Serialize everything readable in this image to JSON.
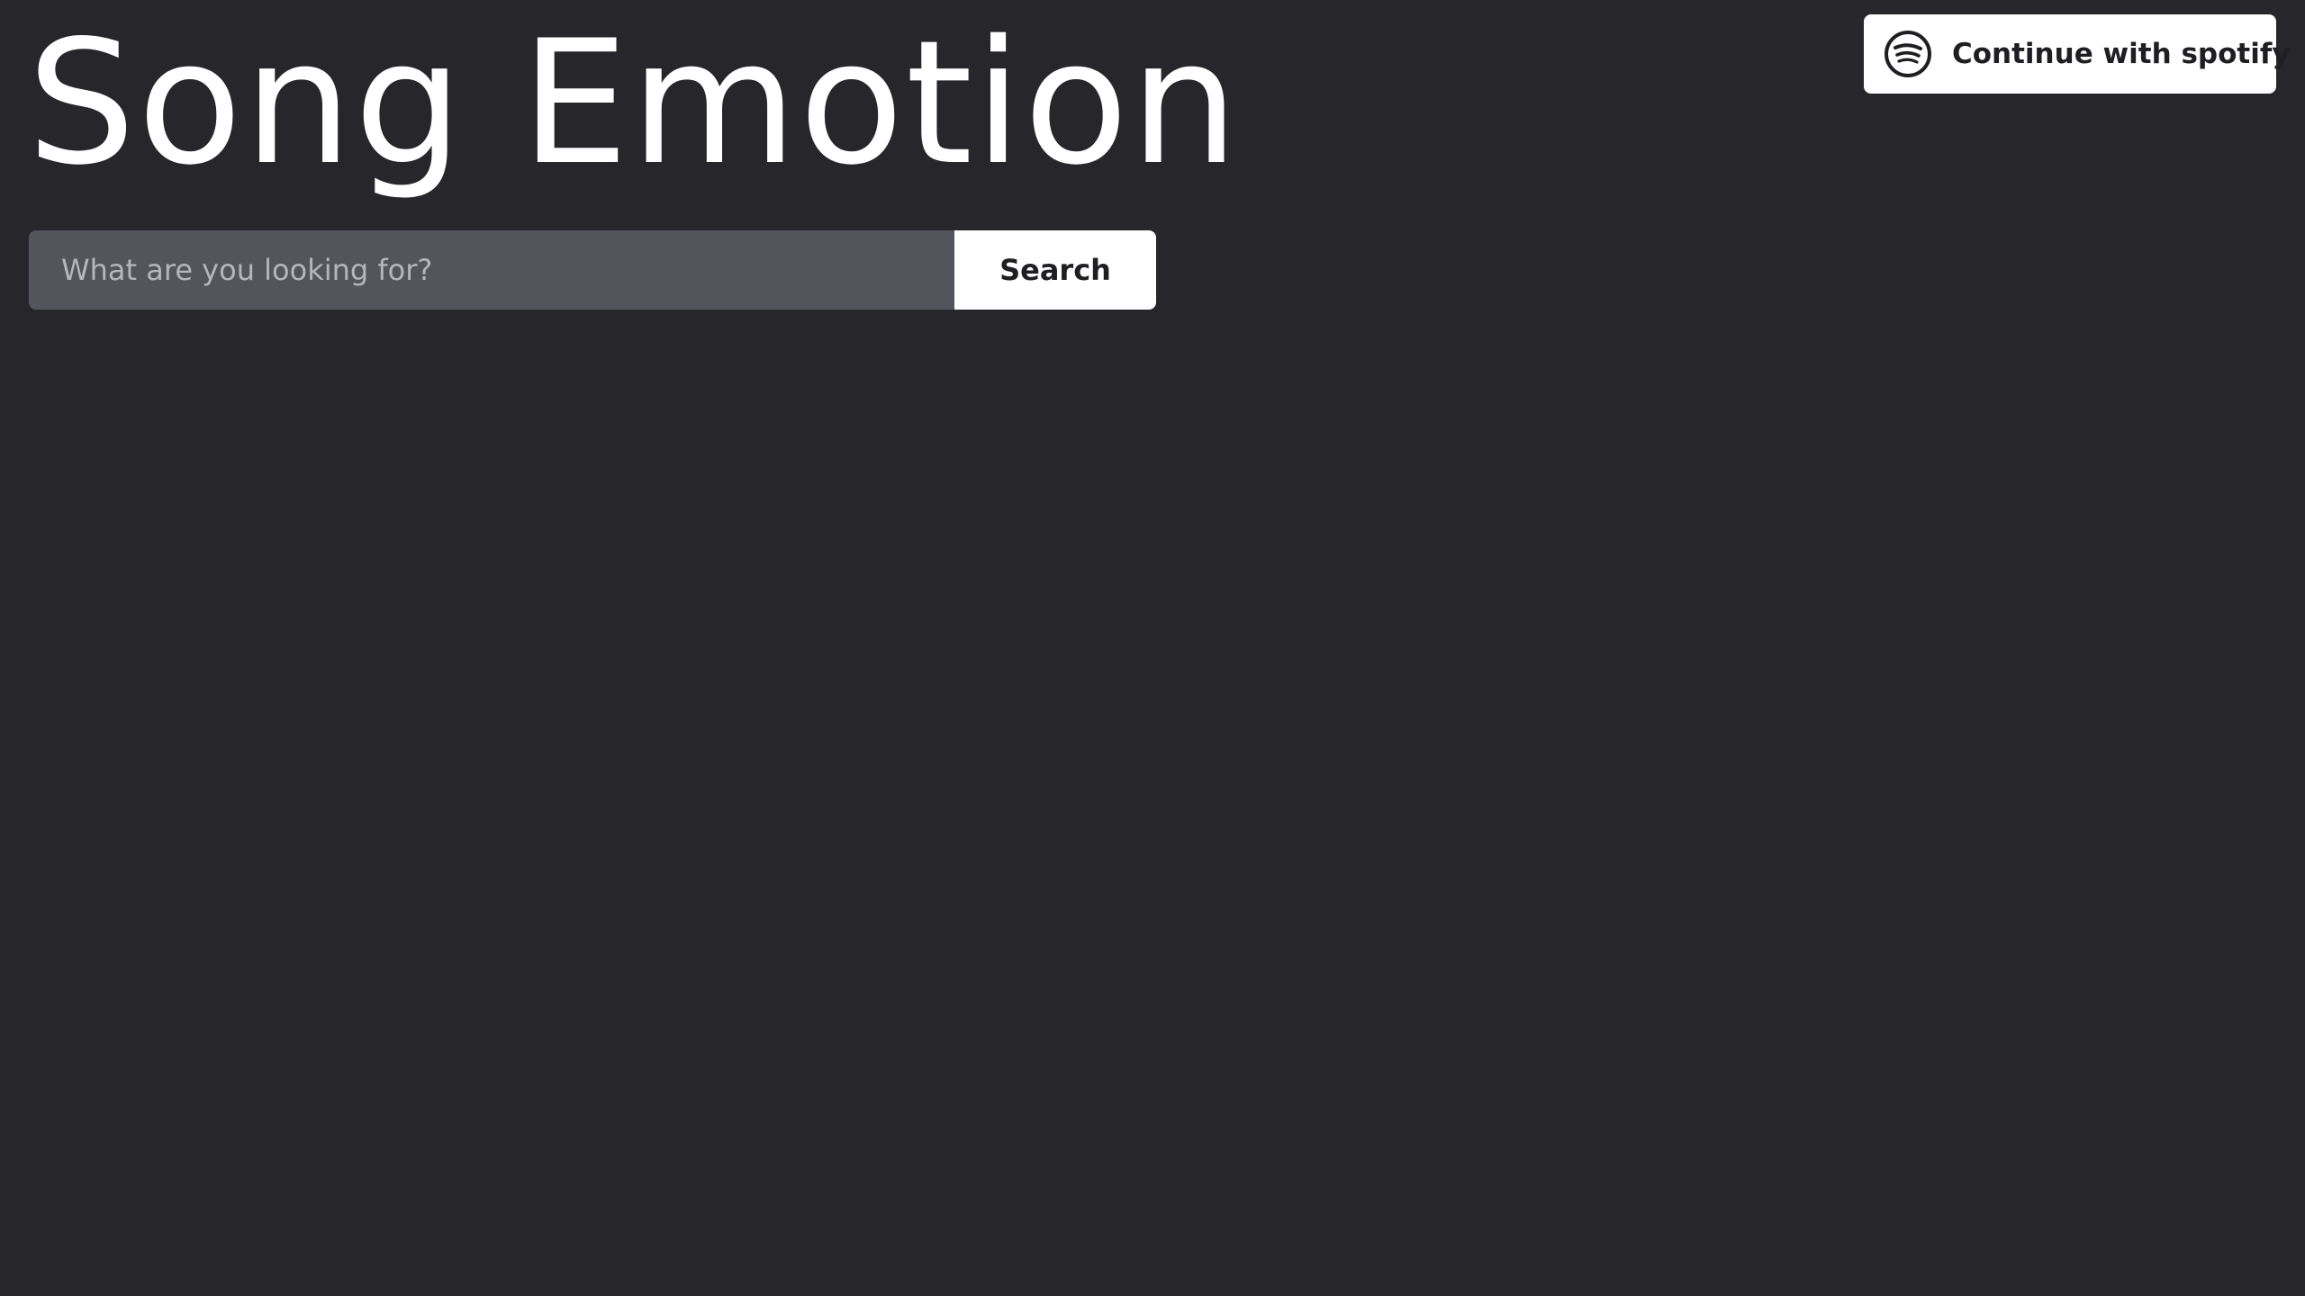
{
  "header": {
    "title": "Song Emotion"
  },
  "search": {
    "placeholder": "What are you looking for?",
    "value": "",
    "button_label": "Search"
  },
  "auth": {
    "spotify_label": "Continue with spotify",
    "icon": "spotify-icon"
  },
  "colors": {
    "background": "#26262b",
    "input_background": "#53545c",
    "button_background": "#ffffff",
    "text_dark": "#1f1f23",
    "text_light": "#ffffff"
  }
}
